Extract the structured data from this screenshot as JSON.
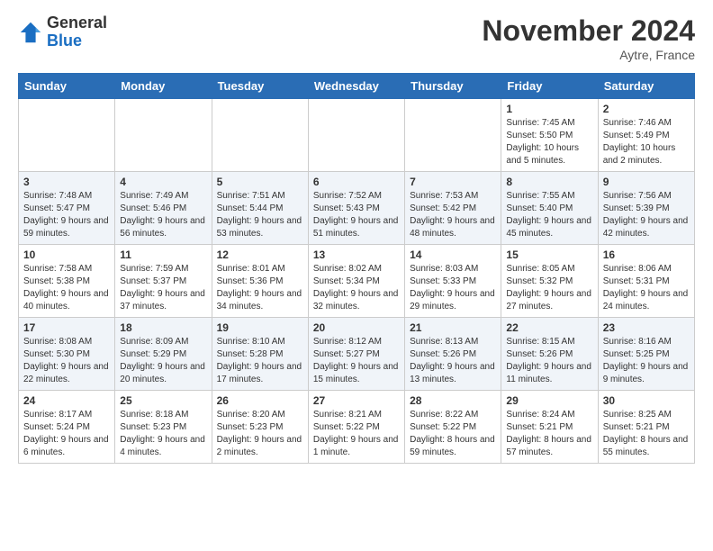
{
  "header": {
    "logo_general": "General",
    "logo_blue": "Blue",
    "month_title": "November 2024",
    "location": "Aytre, France"
  },
  "days_of_week": [
    "Sunday",
    "Monday",
    "Tuesday",
    "Wednesday",
    "Thursday",
    "Friday",
    "Saturday"
  ],
  "weeks": [
    [
      {
        "day": "",
        "info": ""
      },
      {
        "day": "",
        "info": ""
      },
      {
        "day": "",
        "info": ""
      },
      {
        "day": "",
        "info": ""
      },
      {
        "day": "",
        "info": ""
      },
      {
        "day": "1",
        "info": "Sunrise: 7:45 AM\nSunset: 5:50 PM\nDaylight: 10 hours\nand 5 minutes."
      },
      {
        "day": "2",
        "info": "Sunrise: 7:46 AM\nSunset: 5:49 PM\nDaylight: 10 hours\nand 2 minutes."
      }
    ],
    [
      {
        "day": "3",
        "info": "Sunrise: 7:48 AM\nSunset: 5:47 PM\nDaylight: 9 hours\nand 59 minutes."
      },
      {
        "day": "4",
        "info": "Sunrise: 7:49 AM\nSunset: 5:46 PM\nDaylight: 9 hours\nand 56 minutes."
      },
      {
        "day": "5",
        "info": "Sunrise: 7:51 AM\nSunset: 5:44 PM\nDaylight: 9 hours\nand 53 minutes."
      },
      {
        "day": "6",
        "info": "Sunrise: 7:52 AM\nSunset: 5:43 PM\nDaylight: 9 hours\nand 51 minutes."
      },
      {
        "day": "7",
        "info": "Sunrise: 7:53 AM\nSunset: 5:42 PM\nDaylight: 9 hours\nand 48 minutes."
      },
      {
        "day": "8",
        "info": "Sunrise: 7:55 AM\nSunset: 5:40 PM\nDaylight: 9 hours\nand 45 minutes."
      },
      {
        "day": "9",
        "info": "Sunrise: 7:56 AM\nSunset: 5:39 PM\nDaylight: 9 hours\nand 42 minutes."
      }
    ],
    [
      {
        "day": "10",
        "info": "Sunrise: 7:58 AM\nSunset: 5:38 PM\nDaylight: 9 hours\nand 40 minutes."
      },
      {
        "day": "11",
        "info": "Sunrise: 7:59 AM\nSunset: 5:37 PM\nDaylight: 9 hours\nand 37 minutes."
      },
      {
        "day": "12",
        "info": "Sunrise: 8:01 AM\nSunset: 5:36 PM\nDaylight: 9 hours\nand 34 minutes."
      },
      {
        "day": "13",
        "info": "Sunrise: 8:02 AM\nSunset: 5:34 PM\nDaylight: 9 hours\nand 32 minutes."
      },
      {
        "day": "14",
        "info": "Sunrise: 8:03 AM\nSunset: 5:33 PM\nDaylight: 9 hours\nand 29 minutes."
      },
      {
        "day": "15",
        "info": "Sunrise: 8:05 AM\nSunset: 5:32 PM\nDaylight: 9 hours\nand 27 minutes."
      },
      {
        "day": "16",
        "info": "Sunrise: 8:06 AM\nSunset: 5:31 PM\nDaylight: 9 hours\nand 24 minutes."
      }
    ],
    [
      {
        "day": "17",
        "info": "Sunrise: 8:08 AM\nSunset: 5:30 PM\nDaylight: 9 hours\nand 22 minutes."
      },
      {
        "day": "18",
        "info": "Sunrise: 8:09 AM\nSunset: 5:29 PM\nDaylight: 9 hours\nand 20 minutes."
      },
      {
        "day": "19",
        "info": "Sunrise: 8:10 AM\nSunset: 5:28 PM\nDaylight: 9 hours\nand 17 minutes."
      },
      {
        "day": "20",
        "info": "Sunrise: 8:12 AM\nSunset: 5:27 PM\nDaylight: 9 hours\nand 15 minutes."
      },
      {
        "day": "21",
        "info": "Sunrise: 8:13 AM\nSunset: 5:26 PM\nDaylight: 9 hours\nand 13 minutes."
      },
      {
        "day": "22",
        "info": "Sunrise: 8:15 AM\nSunset: 5:26 PM\nDaylight: 9 hours\nand 11 minutes."
      },
      {
        "day": "23",
        "info": "Sunrise: 8:16 AM\nSunset: 5:25 PM\nDaylight: 9 hours\nand 9 minutes."
      }
    ],
    [
      {
        "day": "24",
        "info": "Sunrise: 8:17 AM\nSunset: 5:24 PM\nDaylight: 9 hours\nand 6 minutes."
      },
      {
        "day": "25",
        "info": "Sunrise: 8:18 AM\nSunset: 5:23 PM\nDaylight: 9 hours\nand 4 minutes."
      },
      {
        "day": "26",
        "info": "Sunrise: 8:20 AM\nSunset: 5:23 PM\nDaylight: 9 hours\nand 2 minutes."
      },
      {
        "day": "27",
        "info": "Sunrise: 8:21 AM\nSunset: 5:22 PM\nDaylight: 9 hours\nand 1 minute."
      },
      {
        "day": "28",
        "info": "Sunrise: 8:22 AM\nSunset: 5:22 PM\nDaylight: 8 hours\nand 59 minutes."
      },
      {
        "day": "29",
        "info": "Sunrise: 8:24 AM\nSunset: 5:21 PM\nDaylight: 8 hours\nand 57 minutes."
      },
      {
        "day": "30",
        "info": "Sunrise: 8:25 AM\nSunset: 5:21 PM\nDaylight: 8 hours\nand 55 minutes."
      }
    ]
  ]
}
